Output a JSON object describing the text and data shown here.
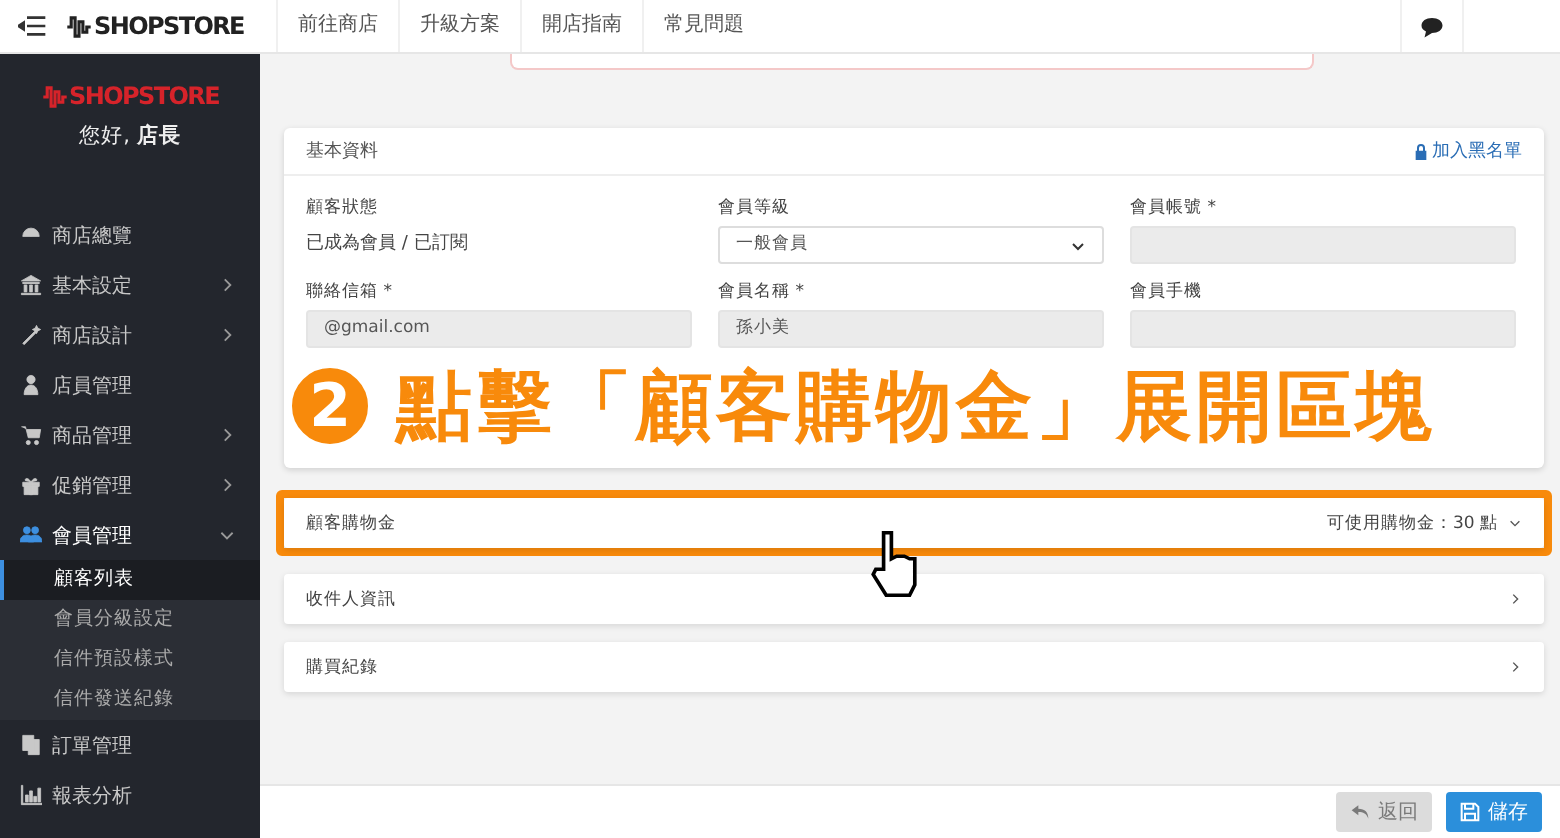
{
  "topbar": {
    "brand": "SHOPSTORE",
    "nav": [
      "前往商店",
      "升級方案",
      "開店指南",
      "常見問題"
    ]
  },
  "sidebar": {
    "brand": "SHOPSTORE",
    "greeting": "您好, **店長**",
    "menu": [
      {
        "label": "商店總覽",
        "kind": "link",
        "selected": false
      },
      {
        "label": "基本設定",
        "kind": "group",
        "selected": false,
        "expanded": false
      },
      {
        "label": "商店設計",
        "kind": "group",
        "selected": false,
        "expanded": false
      },
      {
        "label": "店員管理",
        "kind": "link",
        "selected": false
      },
      {
        "label": "商品管理",
        "kind": "group",
        "selected": false,
        "expanded": false
      },
      {
        "label": "促銷管理",
        "kind": "group",
        "selected": false,
        "expanded": false
      },
      {
        "label": "會員管理",
        "kind": "group",
        "selected": true,
        "expanded": true,
        "children": [
          {
            "label": "顧客列表",
            "selected": true
          },
          {
            "label": "會員分級設定",
            "selected": false
          },
          {
            "label": "信件預設樣式",
            "selected": false
          },
          {
            "label": "信件發送紀錄",
            "selected": false
          }
        ]
      },
      {
        "label": "訂單管理",
        "kind": "link",
        "selected": false
      },
      {
        "label": "報表分析",
        "kind": "link",
        "selected": false
      }
    ]
  },
  "card": {
    "title": "基本資料",
    "action": "加入黑名單",
    "fields": [
      {
        "label": "顧客狀態",
        "kind": "static",
        "value": "已成為會員 / 已訂閱"
      },
      {
        "label": "會員等級",
        "kind": "select",
        "value": "一般會員"
      },
      {
        "label": "會員帳號 *",
        "kind": "input",
        "disabled": true
      },
      {
        "label": "聯絡信箱 *",
        "kind": "input",
        "disabled": true,
        "value": "@gmail.com"
      },
      {
        "label": "會員名稱 *",
        "kind": "input",
        "disabled": true,
        "value": "孫小美"
      },
      {
        "label": "會員手機",
        "kind": "input",
        "disabled": true
      }
    ]
  },
  "annotation": {
    "step": "2",
    "text": "點擊「顧客購物金」展開區塊"
  },
  "sections": [
    {
      "title": "顧客購物金",
      "kind": "summary",
      "summary": "可使用購物金：30 點",
      "highlighted": true
    },
    {
      "title": "收件人資訊",
      "kind": "link",
      "highlighted": false
    },
    {
      "title": "購買紀錄",
      "kind": "link",
      "highlighted": false
    }
  ],
  "footer": {
    "buttons": [
      {
        "label": "返回",
        "kind": "back",
        "disabled": true
      },
      {
        "label": "儲存",
        "kind": "save",
        "disabled": false
      }
    ]
  }
}
